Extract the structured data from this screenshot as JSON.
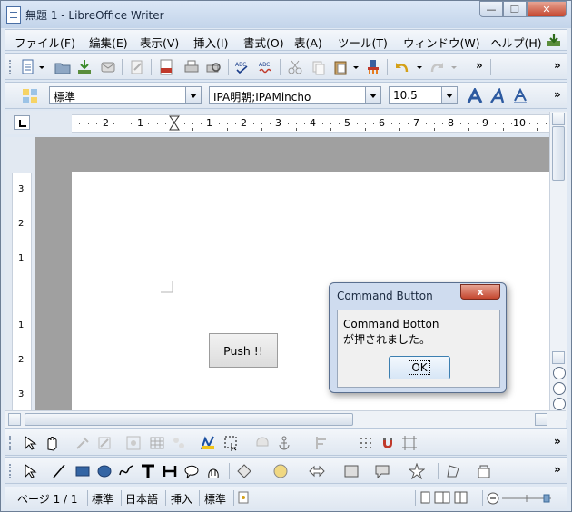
{
  "window": {
    "title": "無題 1 - LibreOffice Writer"
  },
  "menu": {
    "items": [
      "ファイル(F)",
      "編集(E)",
      "表示(V)",
      "挿入(I)",
      "書式(O)",
      "表(A)",
      "ツール(T)",
      "ウィンドウ(W)",
      "ヘルプ(H)"
    ]
  },
  "formatting": {
    "style": "標準",
    "font": "IPA明朝;IPAMincho",
    "size": "10.5"
  },
  "hruler": {
    "labels": [
      "2",
      "1",
      "1",
      "2",
      "3",
      "4",
      "5",
      "6",
      "7",
      "8",
      "9",
      "10"
    ]
  },
  "vruler": {
    "labels": [
      "3",
      "2",
      "1",
      "1",
      "2",
      "3"
    ]
  },
  "toolbar": {
    "more": "»"
  },
  "push_button": {
    "label": "Push !!"
  },
  "dialog": {
    "title": "Command Button",
    "message_line1": "Command Botton",
    "message_line2": "が押されました。",
    "ok": "OK",
    "close": "x"
  },
  "status": {
    "page": "ページ 1 / 1",
    "style": "標準",
    "language": "日本語",
    "insert_mode": "挿入",
    "selection_mode": "標準"
  },
  "colors": {
    "accent": "#3c7fb1",
    "close": "#c4462e"
  }
}
